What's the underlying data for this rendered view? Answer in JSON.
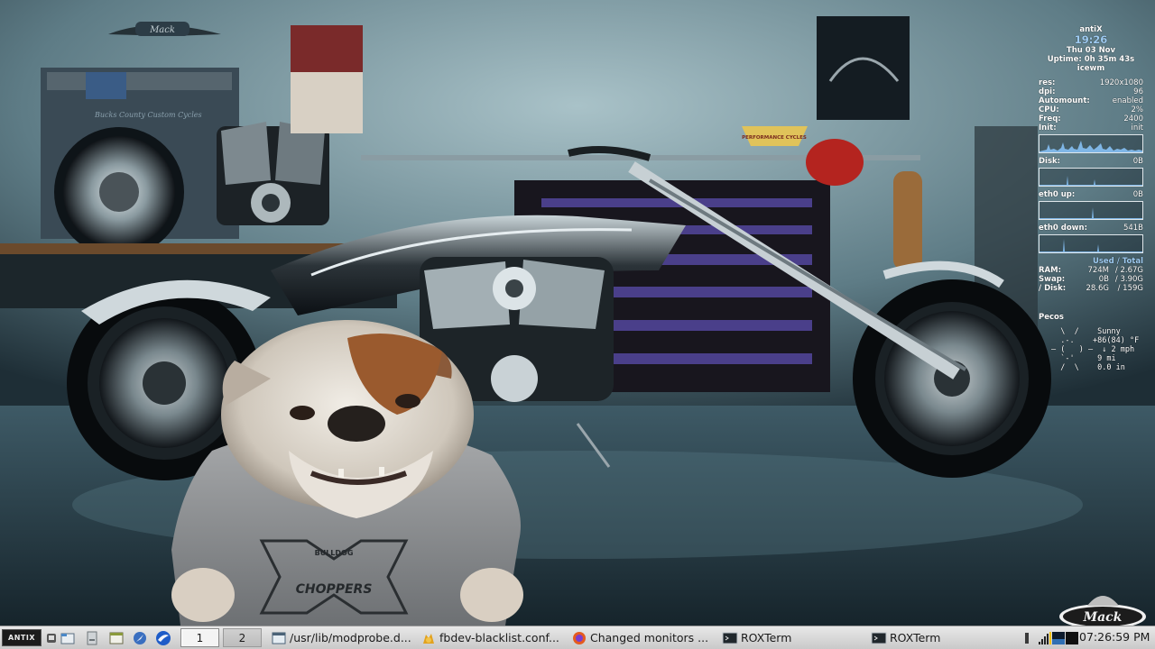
{
  "wallpaper": {
    "brand": "Mack",
    "sign_text": "PERFORMANCE CYCLES",
    "cabinet_text": "Bucks County Custom Cycles",
    "shirt_text_1": "BULLDOG",
    "shirt_text_2": "CHOPPERS"
  },
  "conky": {
    "hostname": "antiX",
    "time": "19:26",
    "date": "Thu 03 Nov",
    "uptime_label": "Uptime:",
    "uptime_value": "0h 35m 43s",
    "wm": "icewm",
    "info": [
      {
        "key": "res:",
        "value": "1920x1080"
      },
      {
        "key": "dpi:",
        "value": "96"
      },
      {
        "key": "Automount:",
        "value": "enabled"
      },
      {
        "key": "CPU:",
        "value": "2%"
      },
      {
        "key": "Freq:",
        "value": "2400"
      },
      {
        "key": "Init:",
        "value": "init"
      }
    ],
    "disk_label": "Disk:",
    "disk_value": "0B",
    "eth_up_label": "eth0 up:",
    "eth_up_value": "0B",
    "eth_down_label": "eth0 down:",
    "eth_down_value": "541B",
    "used_total": "Used / Total",
    "memory": [
      {
        "key": "RAM:",
        "used": "724M",
        "total": "/ 2.67G"
      },
      {
        "key": "Swap:",
        "used": "0B",
        "total": "/ 3.90G"
      },
      {
        "key": "/ Disk:",
        "used": "28.6G",
        "total": "/ 159G"
      }
    ],
    "location": "Pecos",
    "weather": [
      "  \\  /    Sunny",
      "  .-.    +86(84) °F",
      "― (   ) ―  ↓ 2 mph",
      "  `-'     9 mi",
      "  /  \\    0.0 in"
    ],
    "graph_color": "#7fb6e6"
  },
  "taskbar": {
    "start_label": "ANTIX",
    "quick_launch": [
      {
        "name": "show-desktop-icon"
      },
      {
        "name": "file-manager-icon"
      },
      {
        "name": "disk-icon"
      },
      {
        "name": "text-editor-icon"
      },
      {
        "name": "web-browser-icon"
      },
      {
        "name": "mail-client-icon"
      }
    ],
    "workspaces": [
      "1",
      "2"
    ],
    "tasks": [
      {
        "label": "/usr/lib/modprobe.d...",
        "icon": "terminal-window-icon"
      },
      {
        "label": "fbdev-blacklist.conf...",
        "icon": "text-editor-icon"
      },
      {
        "label": "Changed monitors ...",
        "icon": "firefox-icon"
      },
      {
        "label": "ROXTerm",
        "icon": "terminal-icon"
      },
      {
        "label": "ROXTerm",
        "icon": "terminal-icon"
      }
    ],
    "clock": "07:26:59 PM",
    "accent": "#2f6fb3"
  }
}
